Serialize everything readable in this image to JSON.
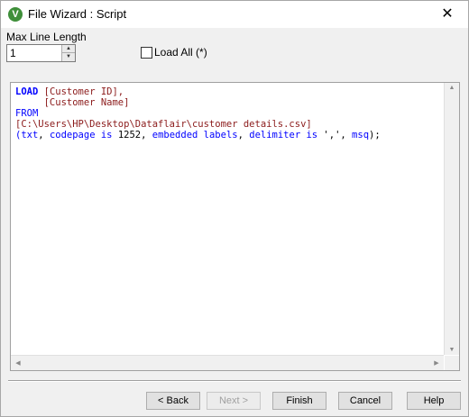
{
  "window": {
    "title": "File Wizard : Script",
    "app_icon_glyph": "V",
    "close_glyph": "✕"
  },
  "options": {
    "max_line_length_label": "Max Line Length",
    "max_line_length_value": "1",
    "load_all_label": "Load All (*)",
    "load_all_checked": false
  },
  "script": {
    "line1_keyword": "LOAD",
    "line1_field": "[Customer ID],",
    "line2_field": "[Customer Name]",
    "line3_keyword": "FROM",
    "line4_path": "[C:\\Users\\HP\\Desktop\\Dataflair\\customer details.csv]",
    "line5": {
      "open": "(",
      "txt": "txt",
      "comma1": ", ",
      "codepage": "codepage is",
      "num": " 1252, ",
      "embedded": "embedded labels",
      "comma2": ", ",
      "delimiter": "delimiter is",
      "delim_value": " ',', ",
      "msq": "msq",
      "close": ");"
    }
  },
  "buttons": {
    "back": "< Back",
    "next": "Next >",
    "finish": "Finish",
    "cancel": "Cancel",
    "help": "Help"
  },
  "colors": {
    "keyword": "#0000ff",
    "field": "#8b1a1a",
    "app_icon": "#3f8f3a"
  }
}
